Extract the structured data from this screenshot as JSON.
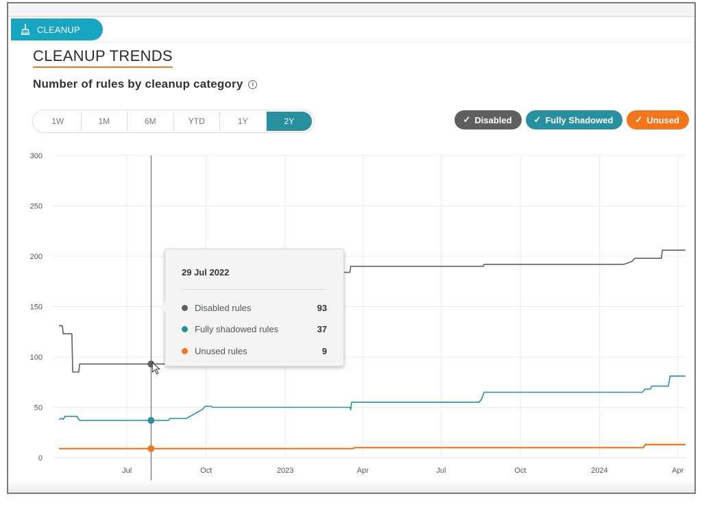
{
  "tab": {
    "label": "CLEANUP",
    "icon": "broom-icon",
    "color": "#17a6c1"
  },
  "section": {
    "title": "CLEANUP TRENDS",
    "subtitle": "Number of rules by cleanup category",
    "info_icon": "info-icon",
    "accent": "#f07a22"
  },
  "range_selector": {
    "options": [
      "1W",
      "1M",
      "6M",
      "YTD",
      "1Y",
      "2Y"
    ],
    "selected": "2Y",
    "active_color": "#26909f"
  },
  "legend": [
    {
      "label": "Disabled",
      "color": "#5f5f5f",
      "checked": true
    },
    {
      "label": "Fully Shadowed",
      "color": "#26909f",
      "checked": true
    },
    {
      "label": "Unused",
      "color": "#f5761a",
      "checked": true
    }
  ],
  "tooltip": {
    "date": "29 Jul 2022",
    "rows": [
      {
        "label": "Disabled rules",
        "value": "93",
        "color": "#5f5f5f"
      },
      {
        "label": "Fully shadowed rules",
        "value": "37",
        "color": "#26909f"
      },
      {
        "label": "Unused rules",
        "value": "9",
        "color": "#f5761a"
      }
    ]
  },
  "chart_data": {
    "type": "line",
    "title": "Number of rules by cleanup category",
    "xlabel": "",
    "ylabel": "",
    "x_unit": "days since 2022-04-01",
    "xlim": [
      12,
      740
    ],
    "ylim": [
      0,
      300
    ],
    "yticks": [
      0,
      50,
      100,
      150,
      200,
      250,
      300
    ],
    "xticks": [
      {
        "label": "Jul",
        "x": 91
      },
      {
        "label": "Oct",
        "x": 183
      },
      {
        "label": "2023",
        "x": 275
      },
      {
        "label": "Apr",
        "x": 365
      },
      {
        "label": "Jul",
        "x": 456
      },
      {
        "label": "Oct",
        "x": 548
      },
      {
        "label": "2024",
        "x": 640
      },
      {
        "label": "Apr",
        "x": 731
      }
    ],
    "grid": true,
    "legend_position": "top-right",
    "hover_x": 119,
    "series": [
      {
        "name": "Disabled rules",
        "color": "#5f5f5f",
        "points": [
          [
            12,
            131
          ],
          [
            16,
            131
          ],
          [
            17,
            123
          ],
          [
            27,
            123
          ],
          [
            28,
            85
          ],
          [
            35,
            85
          ],
          [
            36,
            93
          ],
          [
            340,
            93
          ],
          [
            341,
            184
          ],
          [
            350,
            184
          ],
          [
            351,
            190
          ],
          [
            505,
            190
          ],
          [
            506,
            192
          ],
          [
            668,
            192
          ],
          [
            672,
            193
          ],
          [
            678,
            195
          ],
          [
            681,
            198
          ],
          [
            712,
            198
          ],
          [
            713,
            206
          ],
          [
            740,
            206
          ]
        ]
      },
      {
        "name": "Fully shadowed rules",
        "color": "#26909f",
        "points": [
          [
            12,
            38
          ],
          [
            15,
            39
          ],
          [
            17,
            38
          ],
          [
            19,
            41
          ],
          [
            33,
            41
          ],
          [
            36,
            37
          ],
          [
            139,
            37
          ],
          [
            141,
            39
          ],
          [
            160,
            39
          ],
          [
            179,
            48
          ],
          [
            182,
            51
          ],
          [
            189,
            51
          ],
          [
            191,
            50
          ],
          [
            350,
            50
          ],
          [
            351,
            48
          ],
          [
            352,
            55
          ],
          [
            500,
            55
          ],
          [
            503,
            58
          ],
          [
            506,
            65
          ],
          [
            690,
            65
          ],
          [
            693,
            68
          ],
          [
            699,
            68
          ],
          [
            701,
            71
          ],
          [
            720,
            71
          ],
          [
            722,
            81
          ],
          [
            740,
            81
          ]
        ]
      },
      {
        "name": "Unused rules",
        "color": "#f5761a",
        "points": [
          [
            12,
            9
          ],
          [
            353,
            9
          ],
          [
            356,
            10
          ],
          [
            691,
            10
          ],
          [
            693,
            13
          ],
          [
            740,
            13
          ]
        ]
      }
    ]
  }
}
